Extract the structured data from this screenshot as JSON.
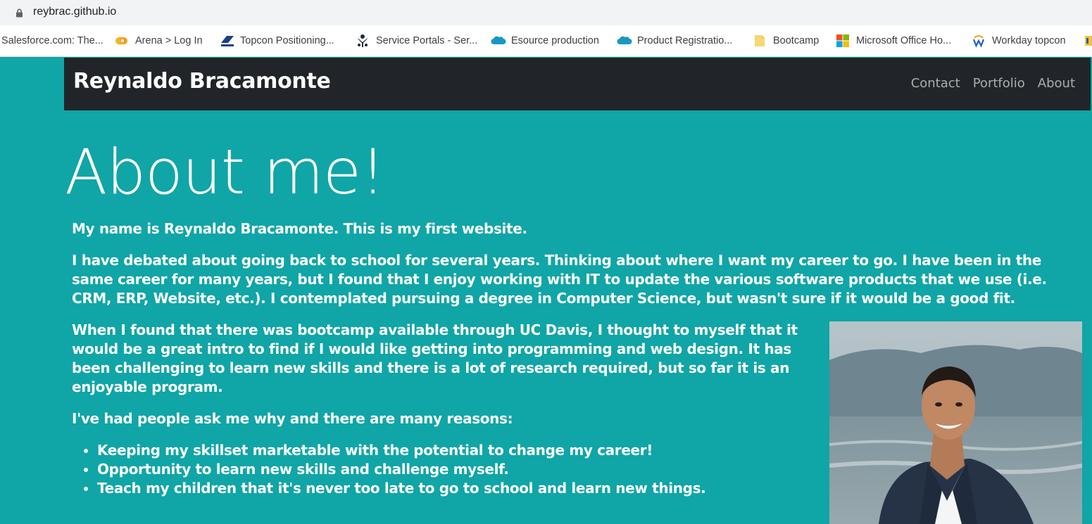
{
  "browser": {
    "url": "reybrac.github.io",
    "bookmarks": [
      {
        "label": "Salesforce.com: The...",
        "icon": "none"
      },
      {
        "label": "Arena > Log In",
        "icon": "arena-icon"
      },
      {
        "label": "Topcon Positioning...",
        "icon": "topcon-icon"
      },
      {
        "label": "Service Portals - Ser...",
        "icon": "service-portal-icon"
      },
      {
        "label": "Esource production",
        "icon": "salesforce-cloud-icon"
      },
      {
        "label": "Product Registratio...",
        "icon": "salesforce-cloud-icon"
      },
      {
        "label": "Bootcamp",
        "icon": "folder-icon"
      },
      {
        "label": "Microsoft Office Ho...",
        "icon": "microsoft-icon"
      },
      {
        "label": "Workday topcon",
        "icon": "workday-icon"
      }
    ]
  },
  "site": {
    "brand": "Reynaldo Bracamonte",
    "nav": [
      "Contact",
      "Portfolio",
      "About"
    ],
    "heading": "About me!",
    "paragraphs": [
      "My name is Reynaldo Bracamonte. This is my first website.",
      "I have debated about going back to school for several years. Thinking about where I want my career to go. I have been in the same career for many years, but I found that I enjoy working with IT to update the various software products that we use (i.e. CRM, ERP, Website, etc.). I contemplated pursuing a degree in Computer Science, but wasn't sure if it would be a good fit.",
      "When I found that there was bootcamp available through UC Davis, I thought to myself that it would be a great intro to find if I would like getting into programming and web design. It has been challenging to learn new skills and there is a lot of research required, but so far it is an enjoyable program.",
      "I've had people ask me why and there are many reasons:"
    ],
    "reasons": [
      "Keeping my skillset marketable with the potential to change my career!",
      "Opportunity to learn new skills and challenge myself.",
      "Teach my children that it's never too late to go to school and learn new things."
    ]
  },
  "colors": {
    "page_background": "#10a5a6",
    "navbar_background": "#212529"
  }
}
